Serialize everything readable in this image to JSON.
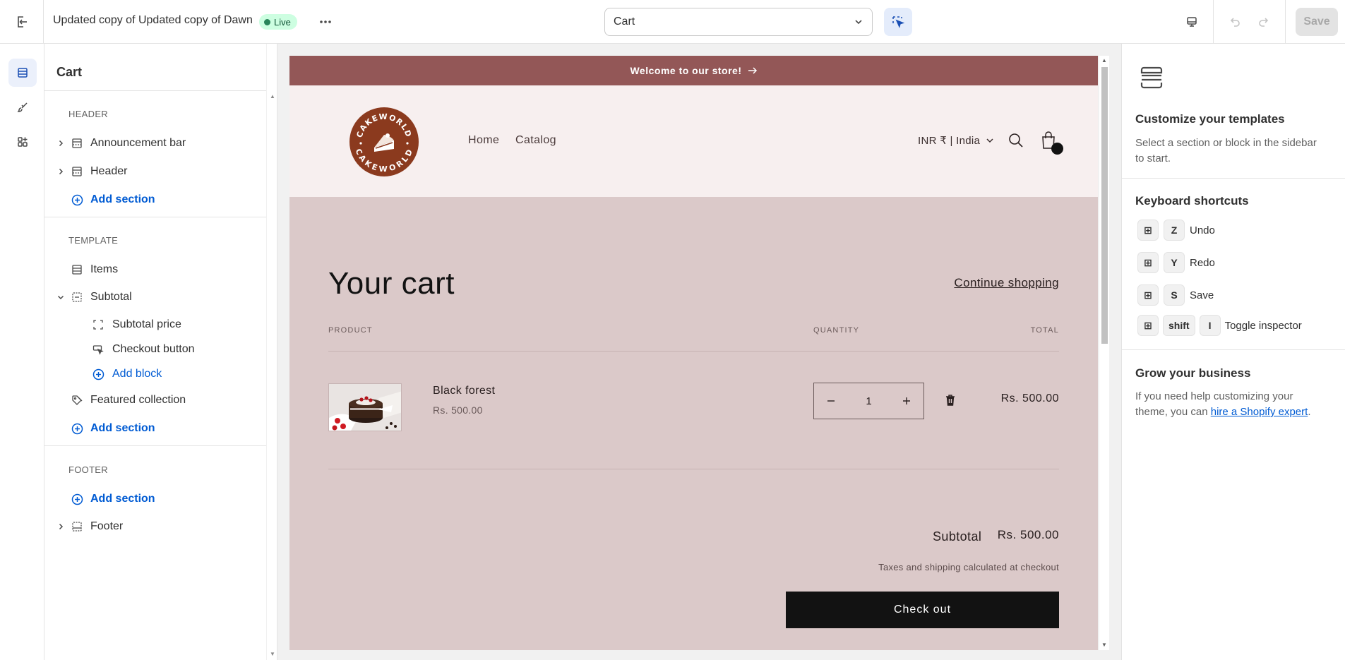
{
  "topbar": {
    "theme_name": "Updated copy of Updated copy of Dawn",
    "status": "Live",
    "template": "Cart",
    "save_label": "Save"
  },
  "sidebar": {
    "title": "Cart",
    "groups": {
      "header": "HEADER",
      "template": "TEMPLATE",
      "footer": "FOOTER"
    },
    "items": {
      "announcement_bar": "Announcement bar",
      "header": "Header",
      "add_section_header": "Add section",
      "items": "Items",
      "subtotal": "Subtotal",
      "subtotal_price": "Subtotal price",
      "checkout_button": "Checkout button",
      "add_block": "Add block",
      "featured_collection": "Featured collection",
      "add_section_template": "Add section",
      "add_section_footer": "Add section",
      "footer": "Footer"
    }
  },
  "preview": {
    "announcement": "Welcome to our store!",
    "logo_text": "CAKEWORLD",
    "nav": [
      "Home",
      "Catalog"
    ],
    "country": "INR ₹ | India",
    "cart_title": "Your cart",
    "continue_shopping": "Continue shopping",
    "columns": {
      "product": "PRODUCT",
      "quantity": "QUANTITY",
      "total": "TOTAL"
    },
    "line_item": {
      "name": "Black forest",
      "price": "Rs. 500.00",
      "quantity": "1",
      "total": "Rs. 500.00"
    },
    "subtotal_label": "Subtotal",
    "subtotal_value": "Rs. 500.00",
    "tax_note": "Taxes and shipping calculated at checkout",
    "checkout_label": "Check out",
    "colors": {
      "announcement_bg": "#935757",
      "header_bg": "#f7efef",
      "page_bg": "#dbc9c9",
      "logo": "#8b3a1e"
    }
  },
  "inspector": {
    "customize_title": "Customize your templates",
    "customize_text": "Select a section or block in the sidebar to start.",
    "shortcuts_title": "Keyboard shortcuts",
    "shortcuts": [
      {
        "key": "Z",
        "label": "Undo"
      },
      {
        "key": "Y",
        "label": "Redo"
      },
      {
        "key": "S",
        "label": "Save"
      },
      {
        "key": "shift",
        "key2": "I",
        "label": "Toggle inspector"
      }
    ],
    "grow_title": "Grow your business",
    "grow_text_before": "If you need help customizing your theme, you can ",
    "grow_link": "hire a Shopify expert",
    "grow_text_after": "."
  }
}
